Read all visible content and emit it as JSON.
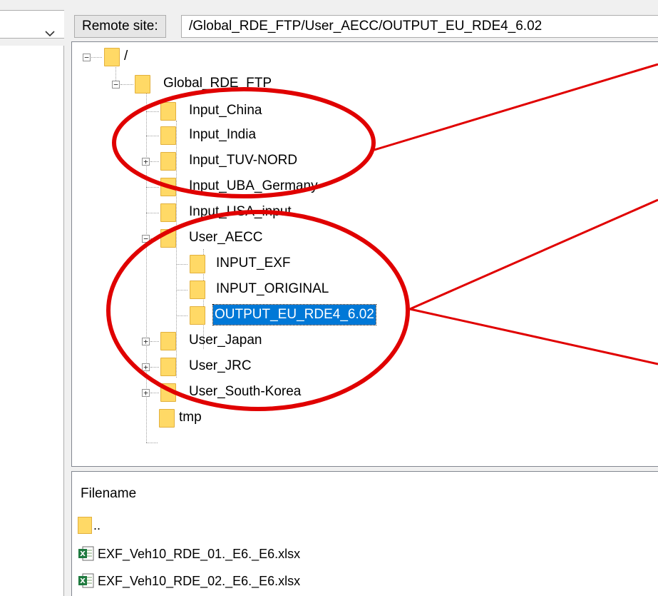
{
  "remote_site": {
    "label": "Remote site:",
    "path": "/Global_RDE_FTP/User_AECC/OUTPUT_EU_RDE4_6.02"
  },
  "tree": {
    "root": "/",
    "global": "Global_RDE_FTP",
    "items": [
      "Input_China",
      "Input_India",
      "Input_TUV-NORD",
      "Input_UBA_Germany",
      "Input_USA_input",
      "User_AECC",
      "INPUT_EXF",
      "INPUT_ORIGINAL",
      "OUTPUT_EU_RDE4_6.02",
      "User_Japan",
      "User_JRC",
      "User_South-Korea",
      "tmp"
    ]
  },
  "files": {
    "column_filename": "Filename",
    "parent": "..",
    "rows": [
      "EXF_Veh10_RDE_01._E6._E6.xlsx",
      "EXF_Veh10_RDE_02._E6._E6.xlsx"
    ]
  },
  "icons": {
    "folder": "folder-icon",
    "excel": "excel-file-icon",
    "expand": "expand-icon",
    "collapse": "collapse-icon",
    "dropdown": "chevron-down-icon"
  },
  "colors": {
    "annotation": "#e00000",
    "selection": "#0078d7",
    "folder": "#ffd966"
  }
}
